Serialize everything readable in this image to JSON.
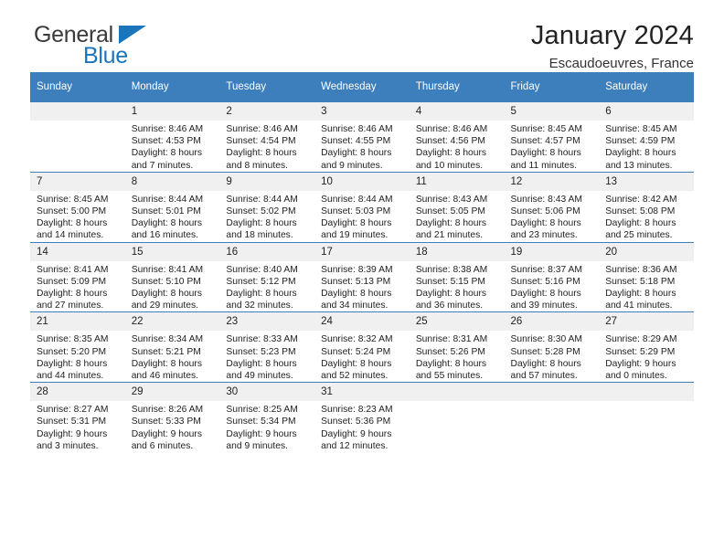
{
  "logo": {
    "word_one": "General",
    "word_two": "Blue",
    "triangle_icon": "blue-triangle-icon",
    "brand_color": "#1b75bb"
  },
  "header": {
    "title": "January 2024",
    "subtitle": "Escaudoeuvres, France"
  },
  "calendar": {
    "header_bg": "#3d7ebd",
    "daynum_bg": "#f0f0f0",
    "columns": [
      "Sunday",
      "Monday",
      "Tuesday",
      "Wednesday",
      "Thursday",
      "Friday",
      "Saturday"
    ],
    "weeks": [
      [
        {
          "day": "",
          "empty": true,
          "lines": []
        },
        {
          "day": "1",
          "lines": [
            "Sunrise: 8:46 AM",
            "Sunset: 4:53 PM",
            "Daylight: 8 hours",
            "and 7 minutes."
          ]
        },
        {
          "day": "2",
          "lines": [
            "Sunrise: 8:46 AM",
            "Sunset: 4:54 PM",
            "Daylight: 8 hours",
            "and 8 minutes."
          ]
        },
        {
          "day": "3",
          "lines": [
            "Sunrise: 8:46 AM",
            "Sunset: 4:55 PM",
            "Daylight: 8 hours",
            "and 9 minutes."
          ]
        },
        {
          "day": "4",
          "lines": [
            "Sunrise: 8:46 AM",
            "Sunset: 4:56 PM",
            "Daylight: 8 hours",
            "and 10 minutes."
          ]
        },
        {
          "day": "5",
          "lines": [
            "Sunrise: 8:45 AM",
            "Sunset: 4:57 PM",
            "Daylight: 8 hours",
            "and 11 minutes."
          ]
        },
        {
          "day": "6",
          "lines": [
            "Sunrise: 8:45 AM",
            "Sunset: 4:59 PM",
            "Daylight: 8 hours",
            "and 13 minutes."
          ]
        }
      ],
      [
        {
          "day": "7",
          "lines": [
            "Sunrise: 8:45 AM",
            "Sunset: 5:00 PM",
            "Daylight: 8 hours",
            "and 14 minutes."
          ]
        },
        {
          "day": "8",
          "lines": [
            "Sunrise: 8:44 AM",
            "Sunset: 5:01 PM",
            "Daylight: 8 hours",
            "and 16 minutes."
          ]
        },
        {
          "day": "9",
          "lines": [
            "Sunrise: 8:44 AM",
            "Sunset: 5:02 PM",
            "Daylight: 8 hours",
            "and 18 minutes."
          ]
        },
        {
          "day": "10",
          "lines": [
            "Sunrise: 8:44 AM",
            "Sunset: 5:03 PM",
            "Daylight: 8 hours",
            "and 19 minutes."
          ]
        },
        {
          "day": "11",
          "lines": [
            "Sunrise: 8:43 AM",
            "Sunset: 5:05 PM",
            "Daylight: 8 hours",
            "and 21 minutes."
          ]
        },
        {
          "day": "12",
          "lines": [
            "Sunrise: 8:43 AM",
            "Sunset: 5:06 PM",
            "Daylight: 8 hours",
            "and 23 minutes."
          ]
        },
        {
          "day": "13",
          "lines": [
            "Sunrise: 8:42 AM",
            "Sunset: 5:08 PM",
            "Daylight: 8 hours",
            "and 25 minutes."
          ]
        }
      ],
      [
        {
          "day": "14",
          "lines": [
            "Sunrise: 8:41 AM",
            "Sunset: 5:09 PM",
            "Daylight: 8 hours",
            "and 27 minutes."
          ]
        },
        {
          "day": "15",
          "lines": [
            "Sunrise: 8:41 AM",
            "Sunset: 5:10 PM",
            "Daylight: 8 hours",
            "and 29 minutes."
          ]
        },
        {
          "day": "16",
          "lines": [
            "Sunrise: 8:40 AM",
            "Sunset: 5:12 PM",
            "Daylight: 8 hours",
            "and 32 minutes."
          ]
        },
        {
          "day": "17",
          "lines": [
            "Sunrise: 8:39 AM",
            "Sunset: 5:13 PM",
            "Daylight: 8 hours",
            "and 34 minutes."
          ]
        },
        {
          "day": "18",
          "lines": [
            "Sunrise: 8:38 AM",
            "Sunset: 5:15 PM",
            "Daylight: 8 hours",
            "and 36 minutes."
          ]
        },
        {
          "day": "19",
          "lines": [
            "Sunrise: 8:37 AM",
            "Sunset: 5:16 PM",
            "Daylight: 8 hours",
            "and 39 minutes."
          ]
        },
        {
          "day": "20",
          "lines": [
            "Sunrise: 8:36 AM",
            "Sunset: 5:18 PM",
            "Daylight: 8 hours",
            "and 41 minutes."
          ]
        }
      ],
      [
        {
          "day": "21",
          "lines": [
            "Sunrise: 8:35 AM",
            "Sunset: 5:20 PM",
            "Daylight: 8 hours",
            "and 44 minutes."
          ]
        },
        {
          "day": "22",
          "lines": [
            "Sunrise: 8:34 AM",
            "Sunset: 5:21 PM",
            "Daylight: 8 hours",
            "and 46 minutes."
          ]
        },
        {
          "day": "23",
          "lines": [
            "Sunrise: 8:33 AM",
            "Sunset: 5:23 PM",
            "Daylight: 8 hours",
            "and 49 minutes."
          ]
        },
        {
          "day": "24",
          "lines": [
            "Sunrise: 8:32 AM",
            "Sunset: 5:24 PM",
            "Daylight: 8 hours",
            "and 52 minutes."
          ]
        },
        {
          "day": "25",
          "lines": [
            "Sunrise: 8:31 AM",
            "Sunset: 5:26 PM",
            "Daylight: 8 hours",
            "and 55 minutes."
          ]
        },
        {
          "day": "26",
          "lines": [
            "Sunrise: 8:30 AM",
            "Sunset: 5:28 PM",
            "Daylight: 8 hours",
            "and 57 minutes."
          ]
        },
        {
          "day": "27",
          "lines": [
            "Sunrise: 8:29 AM",
            "Sunset: 5:29 PM",
            "Daylight: 9 hours",
            "and 0 minutes."
          ]
        }
      ],
      [
        {
          "day": "28",
          "lines": [
            "Sunrise: 8:27 AM",
            "Sunset: 5:31 PM",
            "Daylight: 9 hours",
            "and 3 minutes."
          ]
        },
        {
          "day": "29",
          "lines": [
            "Sunrise: 8:26 AM",
            "Sunset: 5:33 PM",
            "Daylight: 9 hours",
            "and 6 minutes."
          ]
        },
        {
          "day": "30",
          "lines": [
            "Sunrise: 8:25 AM",
            "Sunset: 5:34 PM",
            "Daylight: 9 hours",
            "and 9 minutes."
          ]
        },
        {
          "day": "31",
          "lines": [
            "Sunrise: 8:23 AM",
            "Sunset: 5:36 PM",
            "Daylight: 9 hours",
            "and 12 minutes."
          ]
        },
        {
          "day": "",
          "empty": true,
          "lines": []
        },
        {
          "day": "",
          "empty": true,
          "lines": []
        },
        {
          "day": "",
          "empty": true,
          "lines": []
        }
      ]
    ]
  }
}
